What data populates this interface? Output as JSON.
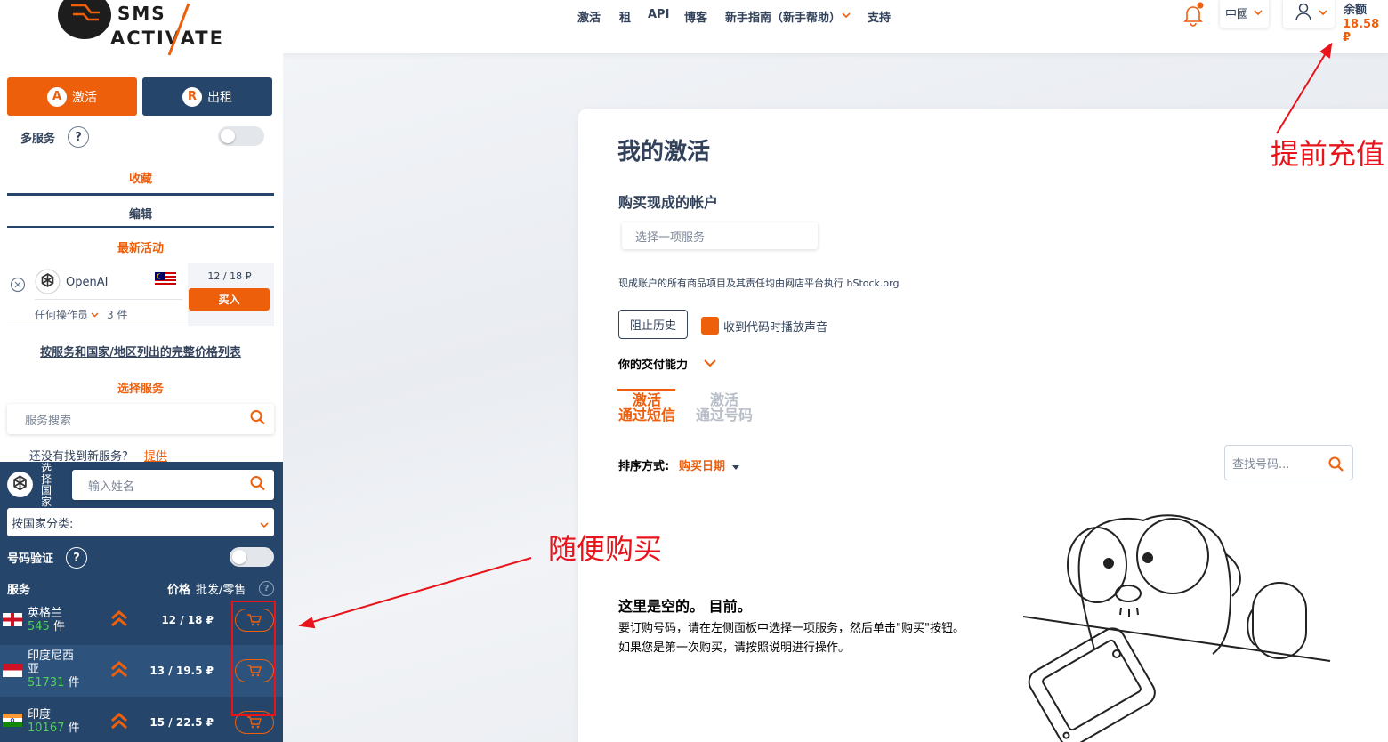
{
  "header": {
    "nav": [
      "激活",
      "租",
      "API",
      "博客",
      "新手指南（新手帮助）",
      "支持"
    ],
    "language": "中國",
    "balance_label": "余额",
    "balance_value": "18.58 ₽"
  },
  "sidebar": {
    "tab_activate": "激活",
    "tab_rent": "出租",
    "multi_service": "多服务",
    "help": "?",
    "favorites": "收藏",
    "edit": "编辑",
    "recent_activity": "最新活动",
    "recent": {
      "service": "OpenAI",
      "price": "12 / 18 ₽",
      "buy": "买入",
      "operator": "任何操作员",
      "count": "3 件"
    },
    "price_list_link": "按服务和国家/地区列出的完整价格列表",
    "choose_service": "选择服务",
    "service_search_placeholder": "服务搜索",
    "not_found": "还没有找到新服务?",
    "suggest": "提供"
  },
  "country_panel": {
    "choose_country": "选择国家",
    "name_placeholder": "输入姓名",
    "category": "按国家分类:",
    "number_verify": "号码验证",
    "col_service": "服务",
    "col_price": "价格",
    "col_wholesale": "批发/零售",
    "rows": [
      {
        "name": "英格兰",
        "count": "545",
        "unit": "件",
        "price": "12 / 18 ₽"
      },
      {
        "name": "印度尼西亚",
        "count": "51731",
        "unit": "件",
        "price": "13 / 19.5 ₽"
      },
      {
        "name": "印度",
        "count": "10167",
        "unit": "件",
        "price": "15 / 22.5 ₽"
      }
    ]
  },
  "main": {
    "title": "我的激活",
    "buy_accounts": "购买现成的帐户",
    "select_service_placeholder": "选择一项服务",
    "note": "现成账户的所有商品项目及其责任均由网店平台执行 hStock.org",
    "block_history": "阻止历史",
    "play_sound": "收到代码时播放声音",
    "delivery_ability": "你的交付能力",
    "tab_sms_line1": "激活",
    "tab_sms_line2": "通过短信",
    "tab_number_line1": "激活",
    "tab_number_line2": "通过号码",
    "sort_by": "排序方式:",
    "sort_value": "购买日期",
    "find_number_placeholder": "查找号码...",
    "empty_title": "这里是空的。 目前。",
    "empty_desc": "要订购号码，请在左侧面板中选择一项服务，然后单击\"购买\"按钮。 如果您是第一次购买，请按照说明进行操作。"
  },
  "annotations": {
    "top_up": "提前充值",
    "buy_any": "随便购买"
  },
  "colors": {
    "accent": "#ee5f0c",
    "navy": "#25456a",
    "annotation_red": "#e8131b",
    "green_count": "#4fd15a"
  }
}
